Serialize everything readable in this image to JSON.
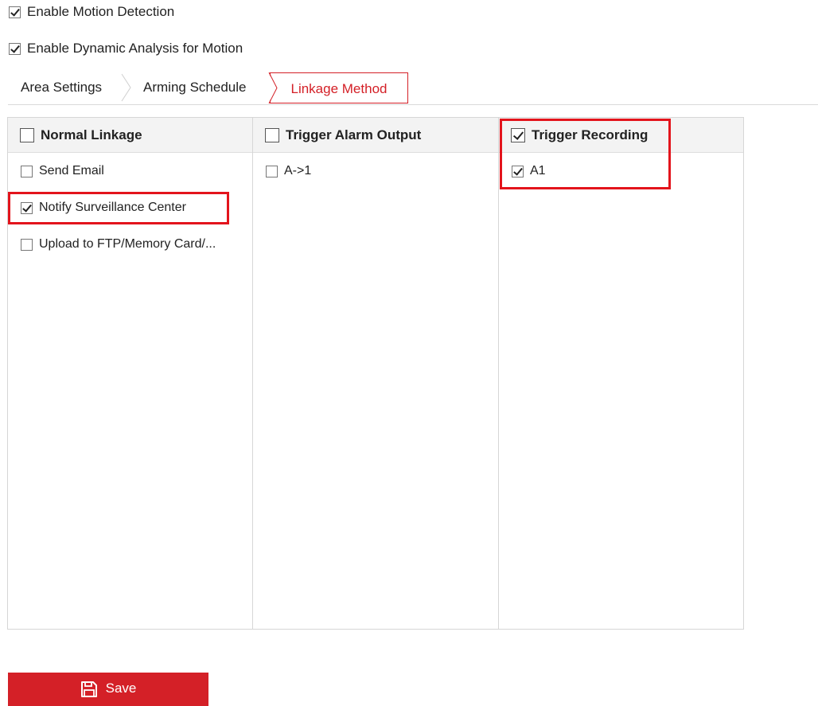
{
  "options": {
    "motion_detection": {
      "label": "Enable Motion Detection",
      "checked": true
    },
    "dynamic_analysis": {
      "label": "Enable Dynamic Analysis for Motion",
      "checked": true
    }
  },
  "tabs": [
    {
      "label": "Area Settings",
      "active": false
    },
    {
      "label": "Arming Schedule",
      "active": false
    },
    {
      "label": "Linkage Method",
      "active": true
    }
  ],
  "linkage": {
    "normal": {
      "header": "Normal Linkage",
      "checked": false,
      "items": [
        {
          "label": "Send Email",
          "checked": false
        },
        {
          "label": "Notify Surveillance Center",
          "checked": true
        },
        {
          "label": "Upload to FTP/Memory Card/...",
          "checked": false
        }
      ]
    },
    "alarm_output": {
      "header": "Trigger Alarm Output",
      "checked": false,
      "items": [
        {
          "label": "A->1",
          "checked": false
        }
      ]
    },
    "recording": {
      "header": "Trigger Recording",
      "checked": true,
      "items": [
        {
          "label": "A1",
          "checked": true
        }
      ]
    }
  },
  "actions": {
    "save_label": "Save",
    "save_icon": "floppy-disk-icon"
  },
  "colors": {
    "accent": "#d42027",
    "highlight": "#e3141c",
    "header_bg": "#f3f3f3",
    "border": "#d6d6d6"
  }
}
